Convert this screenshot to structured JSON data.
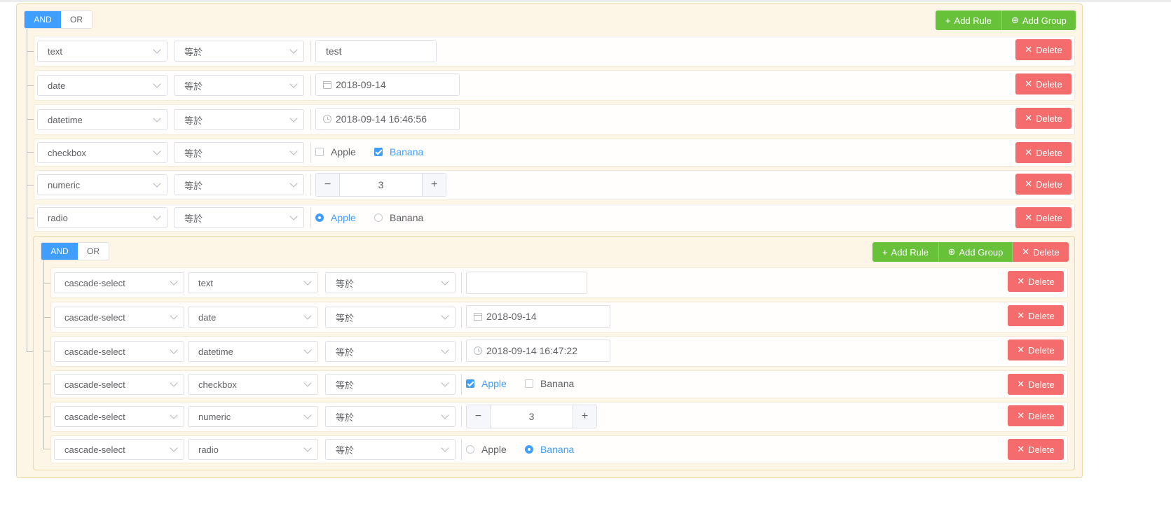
{
  "group": {
    "conjunctions": [
      "AND",
      "OR"
    ],
    "active_conjunction": "AND",
    "add_rule_label": "Add Rule",
    "add_group_label": "Add Group",
    "delete_label": "Delete",
    "rules": [
      {
        "field": "text",
        "operator": "等於",
        "value_type": "text",
        "value": "test"
      },
      {
        "field": "date",
        "operator": "等於",
        "value_type": "date",
        "value": "2018-09-14"
      },
      {
        "field": "datetime",
        "operator": "等於",
        "value_type": "datetime",
        "value": "2018-09-14 16:46:56"
      },
      {
        "field": "checkbox",
        "operator": "等於",
        "value_type": "checkbox",
        "options": [
          {
            "label": "Apple",
            "checked": false
          },
          {
            "label": "Banana",
            "checked": true
          }
        ]
      },
      {
        "field": "numeric",
        "operator": "等於",
        "value_type": "numeric",
        "value": "3",
        "minus": "−",
        "plus": "+"
      },
      {
        "field": "radio",
        "operator": "等於",
        "value_type": "radio",
        "options": [
          {
            "label": "Apple",
            "checked": true
          },
          {
            "label": "Banana",
            "checked": false
          }
        ]
      }
    ],
    "subgroup": {
      "conjunctions": [
        "AND",
        "OR"
      ],
      "active_conjunction": "AND",
      "add_rule_label": "Add Rule",
      "add_group_label": "Add Group",
      "delete_label": "Delete",
      "rules": [
        {
          "field": "cascade-select",
          "subfield": "text",
          "operator": "等於",
          "value_type": "text",
          "value": ""
        },
        {
          "field": "cascade-select",
          "subfield": "date",
          "operator": "等於",
          "value_type": "date",
          "value": "2018-09-14"
        },
        {
          "field": "cascade-select",
          "subfield": "datetime",
          "operator": "等於",
          "value_type": "datetime",
          "value": "2018-09-14 16:47:22"
        },
        {
          "field": "cascade-select",
          "subfield": "checkbox",
          "operator": "等於",
          "value_type": "checkbox",
          "options": [
            {
              "label": "Apple",
              "checked": true
            },
            {
              "label": "Banana",
              "checked": false
            }
          ]
        },
        {
          "field": "cascade-select",
          "subfield": "numeric",
          "operator": "等於",
          "value_type": "numeric",
          "value": "3",
          "minus": "−",
          "plus": "+"
        },
        {
          "field": "cascade-select",
          "subfield": "radio",
          "operator": "等於",
          "value_type": "radio",
          "options": [
            {
              "label": "Apple",
              "checked": false
            },
            {
              "label": "Banana",
              "checked": true
            }
          ]
        }
      ]
    }
  },
  "icons": {
    "plus": "plus-icon",
    "circle_plus": "circle-plus-icon",
    "close": "close-icon",
    "calendar": "calendar-icon",
    "clock": "clock-icon"
  },
  "colors": {
    "primary": "#409eff",
    "success": "#67c23a",
    "danger": "#f56c6c",
    "group_bg": "#fdf5e6"
  }
}
